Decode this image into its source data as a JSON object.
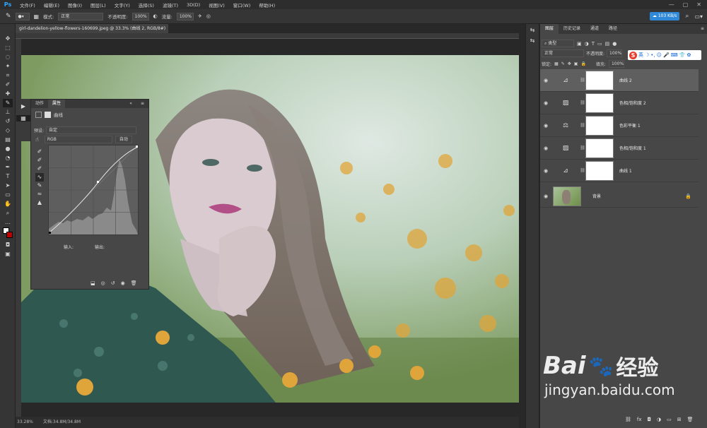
{
  "menubar": {
    "logo": "Ps",
    "items": [
      "文件(F)",
      "编辑(E)",
      "图像(I)",
      "图层(L)",
      "文字(Y)",
      "选择(S)",
      "滤镜(T)",
      "3D(D)",
      "视图(V)",
      "窗口(W)",
      "帮助(H)"
    ],
    "window_controls": [
      "—",
      "▢",
      "✕"
    ]
  },
  "options": {
    "mode_label": "模式:",
    "mode_value": "正常",
    "opacity_label": "不透明度:",
    "opacity_value": "100%",
    "flow_label": "流量:",
    "flow_value": "100%",
    "cloud_speed": "103 KB/s"
  },
  "document": {
    "tab_title": "girl-dandelion-yellow-flowers-160699.jpeg @ 33.3% (曲线 2, RGB/8#) *",
    "zoom": "33.28%",
    "doc_info": "文档:34.8M/34.8M"
  },
  "properties": {
    "tabs": [
      "动作",
      "属性"
    ],
    "active_tab": "属性",
    "title": "曲线",
    "preset_label": "预设:",
    "preset_value": "自定",
    "channel_value": "RGB",
    "auto_label": "自动",
    "input_label": "输入:",
    "output_label": "输出:"
  },
  "layers": {
    "tabs": [
      "图层",
      "历史记录",
      "通道",
      "路径"
    ],
    "active_tab": "图层",
    "kind_label": "类型",
    "blend_mode": "正常",
    "opacity_label": "不透明度:",
    "opacity_value": "100%",
    "lock_label": "锁定:",
    "fill_label": "填充:",
    "fill_value": "100%",
    "rows": [
      {
        "name": "曲线 2",
        "icon": "curves-icon",
        "selected": true
      },
      {
        "name": "色相/饱和度 2",
        "icon": "hue-saturation-icon",
        "selected": false
      },
      {
        "name": "色彩平衡 1",
        "icon": "color-balance-icon",
        "selected": false
      },
      {
        "name": "色相/饱和度 1",
        "icon": "hue-saturation-icon",
        "selected": false
      },
      {
        "name": "曲线 1",
        "icon": "curves-icon",
        "selected": false
      },
      {
        "name": "背景",
        "icon": "photo-thumbnail",
        "selected": false
      }
    ]
  },
  "ime": {
    "label": "英"
  },
  "watermark": {
    "brand": "Bai",
    "brand2": "经验",
    "url": "jingyan.baidu.com"
  },
  "colors": {
    "accent": "#31a8ff",
    "selection": "#5f5f5f",
    "ime_red": "#e8392b"
  }
}
